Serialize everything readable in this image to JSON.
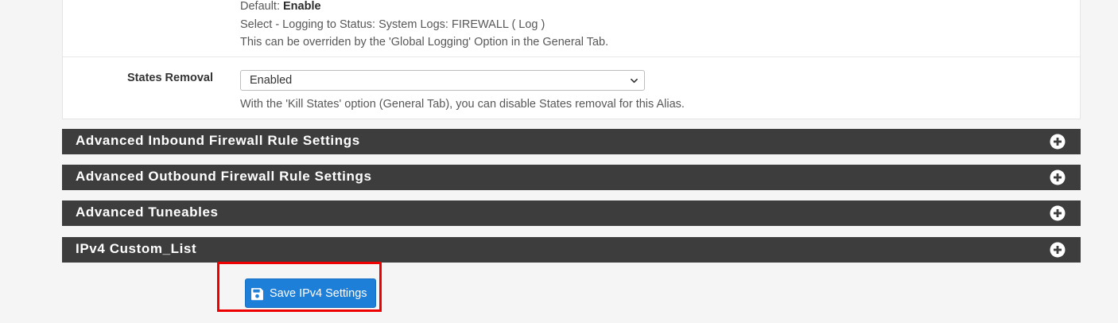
{
  "logging": {
    "default_prefix": "Default: ",
    "default_value": "Enable",
    "line2": "Select - Logging to Status: System Logs: FIREWALL ( Log )",
    "line3": "This can be overriden by the 'Global Logging' Option in the General Tab."
  },
  "states_removal": {
    "label": "States Removal",
    "selected": "Enabled",
    "help": "With the 'Kill States' option (General Tab), you can disable States removal for this Alias."
  },
  "sections": [
    {
      "title": "Advanced Inbound Firewall Rule Settings",
      "icon": "plus-circle-icon"
    },
    {
      "title": "Advanced Outbound Firewall Rule Settings",
      "icon": "plus-circle-icon"
    },
    {
      "title": "Advanced Tuneables",
      "icon": "plus-circle-icon"
    },
    {
      "title": "IPv4 Custom_List",
      "icon": "plus-circle-icon"
    }
  ],
  "save_button": {
    "label": "Save IPv4 Settings",
    "icon": "floppy-disk-icon"
  },
  "colors": {
    "section_bar": "#3d3d3d",
    "button": "#1e7fd8",
    "highlight": "#ee0000"
  }
}
